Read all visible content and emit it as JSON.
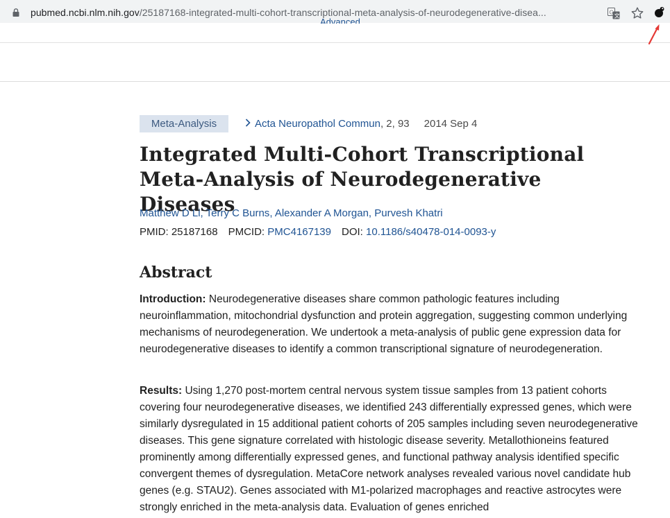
{
  "browser": {
    "url_host": "pubmed.ncbi.nlm.nih.gov",
    "url_path": "/25187168-integrated-multi-cohort-transcriptional-meta-analysis-of-neurodegenerative-disea..."
  },
  "header": {
    "advanced_link": "Advanced"
  },
  "article": {
    "type_badge": "Meta-Analysis",
    "journal": "Acta Neuropathol Commun",
    "citation": ", 2, 93",
    "date": "2014 Sep 4",
    "title": "Integrated Multi-Cohort Transcriptional Meta-Analysis of Neurodegenerative Diseases",
    "authors": [
      "Matthew D Li",
      "Terry C Burns",
      "Alexander A Morgan",
      "Purvesh Khatri"
    ],
    "pmid_label": "PMID:",
    "pmid": "25187168",
    "pmcid_label": "PMCID:",
    "pmcid": "PMC4167139",
    "doi_label": "DOI:",
    "doi": "10.1186/s40478-014-0093-y"
  },
  "abstract": {
    "heading": "Abstract",
    "sections": [
      {
        "label": "Introduction:",
        "text": "Neurodegenerative diseases share common pathologic features including neuroinflammation, mitochondrial dysfunction and protein aggregation, suggesting common underlying mechanisms of neurodegeneration. We undertook a meta-analysis of public gene expression data for neurodegenerative diseases to identify a common transcriptional signature of neurodegeneration."
      },
      {
        "label": "Results:",
        "text": "Using 1,270 post-mortem central nervous system tissue samples from 13 patient cohorts covering four neurodegenerative diseases, we identified 243 differentially expressed genes, which were similarly dysregulated in 15 additional patient cohorts of 205 samples including seven neurodegenerative diseases. This gene signature correlated with histologic disease severity. Metallothioneins featured prominently among differentially expressed genes, and functional pathway analysis identified specific convergent themes of dysregulation. MetaCore network analyses revealed various novel candidate hub genes (e.g. STAU2). Genes associated with M1-polarized macrophages and reactive astrocytes were strongly enriched in the meta-analysis data. Evaluation of genes enriched"
      }
    ]
  },
  "colors": {
    "link": "#205493",
    "badge_bg": "#dbe3ee",
    "annotation_arrow": "#e53935"
  }
}
